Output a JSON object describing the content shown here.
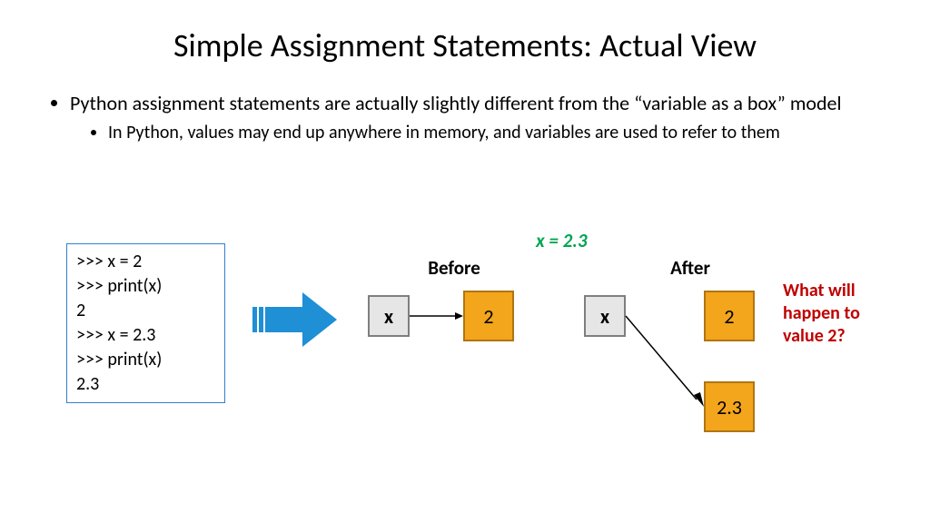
{
  "title": "Simple Assignment Statements: Actual View",
  "bullets": {
    "main": "Python assignment statements are actually slightly different from the “variable as a box” model",
    "sub": "In Python, values may end up anywhere in memory, and variables are used to refer to them"
  },
  "code": {
    "l1": ">>> x = 2",
    "l2": ">>> print(x)",
    "l3": "2",
    "l4": ">>> x = 2.3",
    "l5": ">>> print(x)",
    "l6": "2.3"
  },
  "assign_text": "x = 2.3",
  "before": {
    "label": "Before",
    "var": "x",
    "val": "2"
  },
  "after": {
    "label": "After",
    "var": "x",
    "val1": "2",
    "val2": "2.3"
  },
  "question": "What will happen to value 2?"
}
